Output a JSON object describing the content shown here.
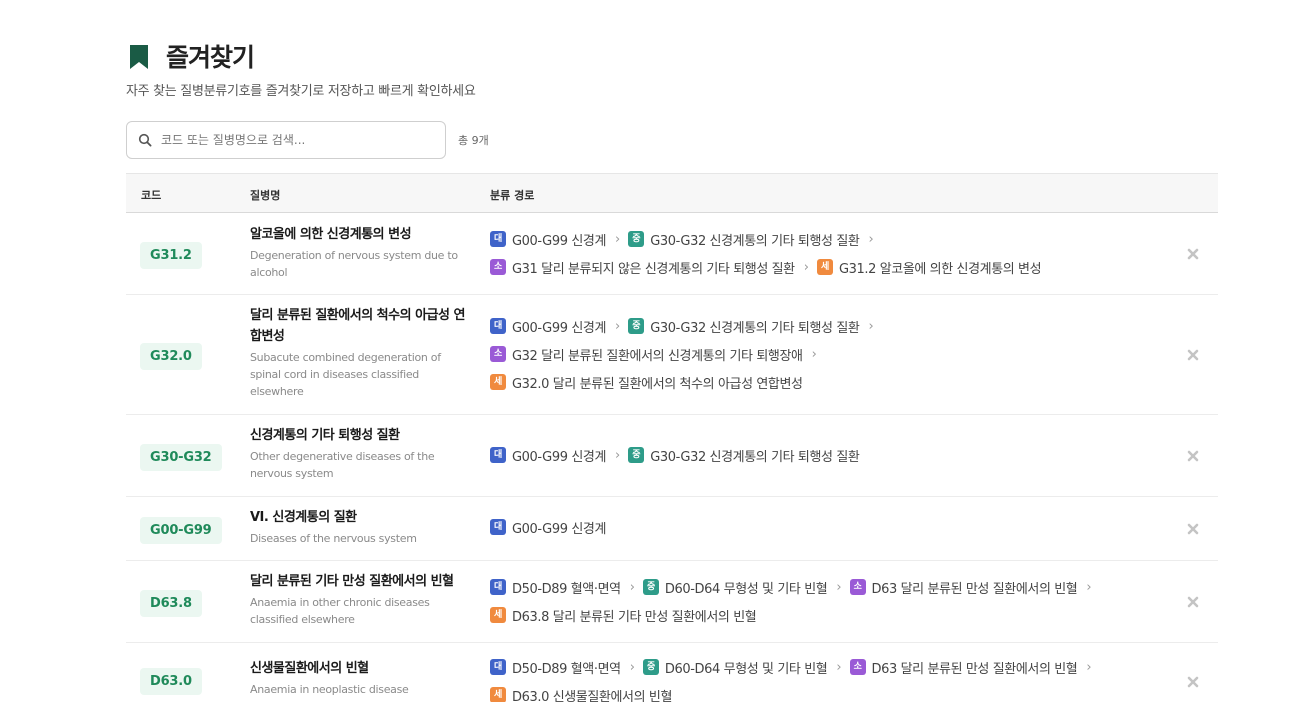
{
  "header": {
    "title": "즐겨찾기",
    "subtitle": "자주 찾는 질병분류기호를 즐겨찾기로 저장하고 빠르게 확인하세요"
  },
  "search": {
    "placeholder": "코드 또는 질병명으로 검색...",
    "value": ""
  },
  "total": "총 9개",
  "columns": {
    "code": "코드",
    "name": "질병명",
    "path": "분류 경로"
  },
  "level_labels": {
    "dae": "대",
    "jung": "중",
    "so": "소",
    "se": "세"
  },
  "colors": {
    "accent": "#1f8a5a",
    "badge_bg": "#ebf7f1",
    "dae": "#3f63c9",
    "jung": "#2e9c89",
    "so": "#9a5ad6",
    "se": "#f08a3e",
    "bookmark": "#1a5b45"
  },
  "rows": [
    {
      "code": "G31.2",
      "name_ko": "알코올에 의한 신경계통의 변성",
      "name_en": "Degeneration of nervous system due to alcohol",
      "path": [
        "G00-G99 신경계",
        "G30-G32 신경계통의 기타 퇴행성 질환",
        "G31 달리 분류되지 않은 신경계통의 기타 퇴행성 질환",
        "G31.2 알코올에 의한 신경계통의 변성"
      ]
    },
    {
      "code": "G32.0",
      "name_ko": "달리 분류된 질환에서의 척수의 아급성 연합변성",
      "name_en": "Subacute combined degeneration of spinal cord in diseases classified elsewhere",
      "path": [
        "G00-G99 신경계",
        "G30-G32 신경계통의 기타 퇴행성 질환",
        "G32 달리 분류된 질환에서의 신경계통의 기타 퇴행장애",
        "G32.0 달리 분류된 질환에서의 척수의 아급성 연합변성"
      ]
    },
    {
      "code": "G30-G32",
      "name_ko": "신경계통의 기타 퇴행성 질환",
      "name_en": "Other degenerative diseases of the nervous system",
      "path": [
        "G00-G99 신경계",
        "G30-G32 신경계통의 기타 퇴행성 질환"
      ]
    },
    {
      "code": "G00-G99",
      "name_ko": "VI. 신경계통의 질환",
      "name_en": "Diseases of the nervous system",
      "path": [
        "G00-G99 신경계"
      ]
    },
    {
      "code": "D63.8",
      "name_ko": "달리 분류된 기타 만성 질환에서의 빈혈",
      "name_en": "Anaemia in other chronic diseases classified elsewhere",
      "path": [
        "D50-D89 혈액·면역",
        "D60-D64 무형성 및 기타 빈혈",
        "D63 달리 분류된 만성 질환에서의 빈혈",
        "D63.8 달리 분류된 기타 만성 질환에서의 빈혈"
      ]
    },
    {
      "code": "D63.0",
      "name_ko": "신생물질환에서의 빈혈",
      "name_en": "Anaemia in neoplastic disease",
      "path": [
        "D50-D89 혈액·면역",
        "D60-D64 무형성 및 기타 빈혈",
        "D63 달리 분류된 만성 질환에서의 빈혈",
        "D63.0 신생물질환에서의 빈혈"
      ]
    }
  ]
}
